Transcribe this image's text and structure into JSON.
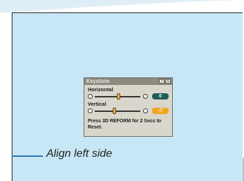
{
  "colors": {
    "panel_bg": "#c7e7f6",
    "dialog_bg": "#d9d6cb",
    "title_bar": "#8e8a80",
    "accent_line": "#2a6fb6",
    "horizontal_value_bg": "#1f5e57",
    "vertical_value_bg": "#f2a422"
  },
  "dialog": {
    "title": "Keystone",
    "buttons": [
      "?",
      "X"
    ],
    "horizontal": {
      "label": "Horizontal",
      "value": "0",
      "level": 0.5
    },
    "vertical": {
      "label": "Vertical",
      "value": "-7",
      "level": 0.4
    },
    "hint": "Press 3D REFORM for 2 Secs to Reset."
  },
  "caption": "Align left side"
}
